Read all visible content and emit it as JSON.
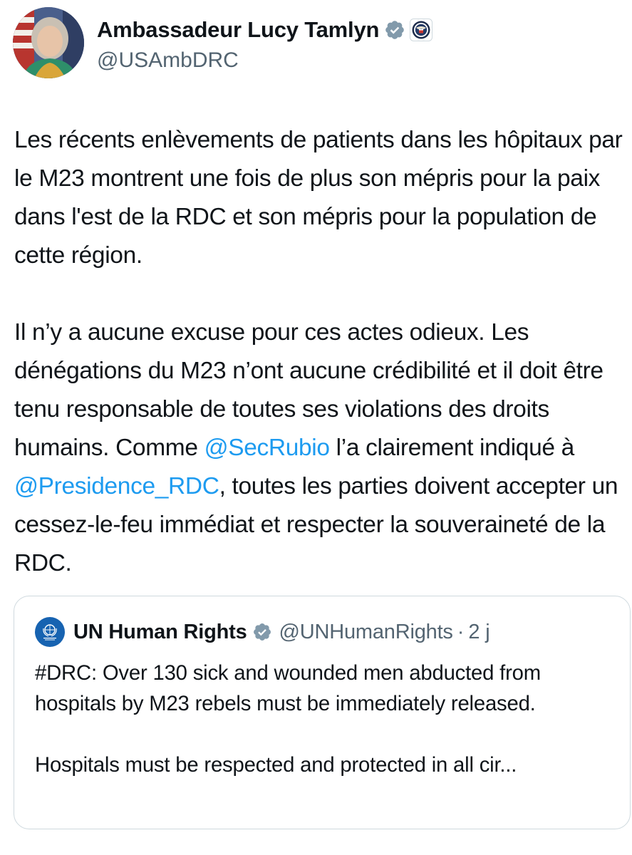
{
  "author": {
    "display_name": "Ambassadeur Lucy Tamlyn",
    "handle": "@USAmbDRC"
  },
  "tweet": {
    "paragraphs": [
      [
        {
          "text": "Les récents enlèvements de patients dans les hôpitaux par le M23 montrent une fois de plus son mépris pour la paix dans l'est de la RDC et son mépris pour la population de cette région.",
          "mention": false
        }
      ],
      [
        {
          "text": "Il n’y a aucune excuse pour ces actes odieux. Les dénégations du M23 n’ont aucune crédibilité et il doit être tenu responsable de toutes ses violations des droits humains. Comme ",
          "mention": false
        },
        {
          "text": "@SecRubio",
          "mention": true
        },
        {
          "text": " l’a clairement indiqué à ",
          "mention": false
        },
        {
          "text": "@Presidence_RDC",
          "mention": true
        },
        {
          "text": ", toutes les parties doivent accepter un cessez-le-feu immédiat et respecter la souveraineté de la RDC.",
          "mention": false
        }
      ]
    ]
  },
  "quoted_tweet": {
    "display_name": "UN Human Rights",
    "handle": "@UNHumanRights",
    "separator": "·",
    "time": "2 j",
    "paragraphs": [
      "#DRC: Over 130 sick and wounded men abducted from hospitals by M23 rebels must be immediately released.",
      "Hospitals must be respected and protected in all cir..."
    ]
  },
  "colors": {
    "text": "#0f1419",
    "secondary": "#536471",
    "link": "#1d9bf0",
    "border": "#cfd9de",
    "verified_badge": "#829aab"
  },
  "icons": {
    "author_badge": "verified-badge-icon",
    "affiliation": "us-state-department-seal-icon",
    "quote_badge": "verified-badge-icon",
    "quote_avatar": "un-human-rights-logo-icon"
  }
}
